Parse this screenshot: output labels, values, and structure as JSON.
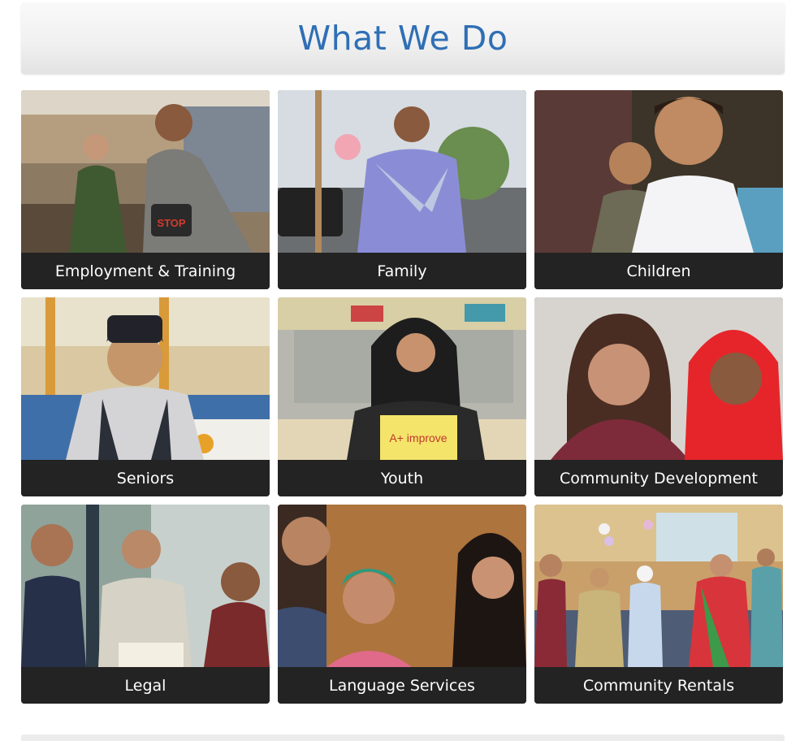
{
  "header": {
    "title": "What We Do"
  },
  "tiles": [
    {
      "label": "Employment & Training",
      "photo_icon": "employment-photo-icon"
    },
    {
      "label": "Family",
      "photo_icon": "family-photo-icon"
    },
    {
      "label": "Children",
      "photo_icon": "children-photo-icon"
    },
    {
      "label": "Seniors",
      "photo_icon": "seniors-photo-icon"
    },
    {
      "label": "Youth",
      "photo_icon": "youth-photo-icon"
    },
    {
      "label": "Community Development",
      "photo_icon": "community-development-photo-icon"
    },
    {
      "label": "Legal",
      "photo_icon": "legal-photo-icon"
    },
    {
      "label": "Language Services",
      "photo_icon": "language-services-photo-icon"
    },
    {
      "label": "Community Rentals",
      "photo_icon": "community-rentals-photo-icon"
    }
  ],
  "sign": {
    "text": "A+ improve"
  },
  "shirt": {
    "text": "STOP"
  },
  "colors": {
    "title": "#2f6fb5",
    "caption_bg": "#232323",
    "caption_text": "#ffffff"
  }
}
